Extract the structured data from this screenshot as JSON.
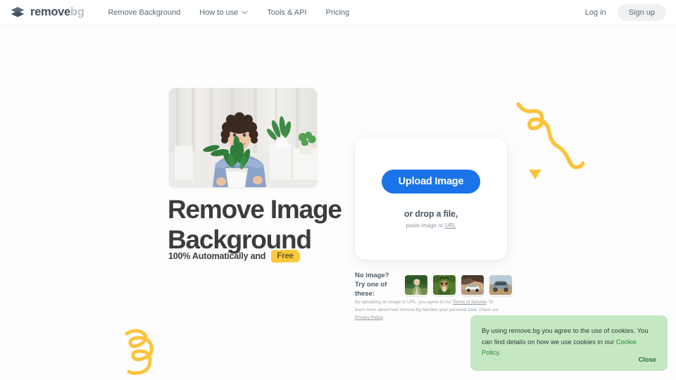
{
  "brand": {
    "logo_icon": "layers-diamond-icon",
    "name_primary": "remove",
    "name_secondary": "bg"
  },
  "header": {
    "nav": [
      {
        "label": "Remove Background",
        "has_dropdown": false
      },
      {
        "label": "How to use",
        "has_dropdown": true
      },
      {
        "label": "Tools & API",
        "has_dropdown": false
      },
      {
        "label": "Pricing",
        "has_dropdown": false
      }
    ],
    "login_label": "Log in",
    "signup_label": "Sign up"
  },
  "hero": {
    "photo_alt": "Smiling man with curly hair in blue t-shirt holding a potted plant",
    "headline_line1": "Remove Image",
    "headline_line2": "Background",
    "subline": "100% Automatically and",
    "free_badge": "Free"
  },
  "upload": {
    "button_label": "Upload Image",
    "drop_text": "or drop a file,",
    "paste_prefix": "paste image or ",
    "paste_link": "URL"
  },
  "samples": {
    "label_line1": "No image?",
    "label_line2": "Try one of these:",
    "thumbs": [
      {
        "alt": "Man in green jacket outdoors"
      },
      {
        "alt": "Antelope with horns in greenery"
      },
      {
        "alt": "White car near rock tunnel"
      },
      {
        "alt": "Off-road vehicle in desert"
      }
    ]
  },
  "disclaimer": {
    "part1": "By uploading an image or URL, you agree to our ",
    "link1": "Terms of Service",
    "part2": ". To learn more about how remove.bg handles your personal data, check our ",
    "link2": "Privacy Policy",
    "part3": "."
  },
  "cookie": {
    "part1": "By using remove.bg you agree to the use of cookies. You can find details on how we use cookies in our ",
    "link": "Cookie Policy",
    "part2": ".",
    "close_label": "Close"
  },
  "decorations": {
    "squiggle_top_right": "yellow-squiggle-icon",
    "triangle": "yellow-triangle-icon",
    "swirl_bottom_left": "yellow-swirl-icon"
  },
  "colors": {
    "accent_blue": "#1a73e8",
    "accent_yellow": "#fcc93b",
    "cookie_green_bg": "#c5e8c2",
    "cookie_green_text": "#21772f",
    "text_dark": "#3c3c3c",
    "text_muted": "#5a6a76",
    "page_bg": "#fdfdfd"
  }
}
